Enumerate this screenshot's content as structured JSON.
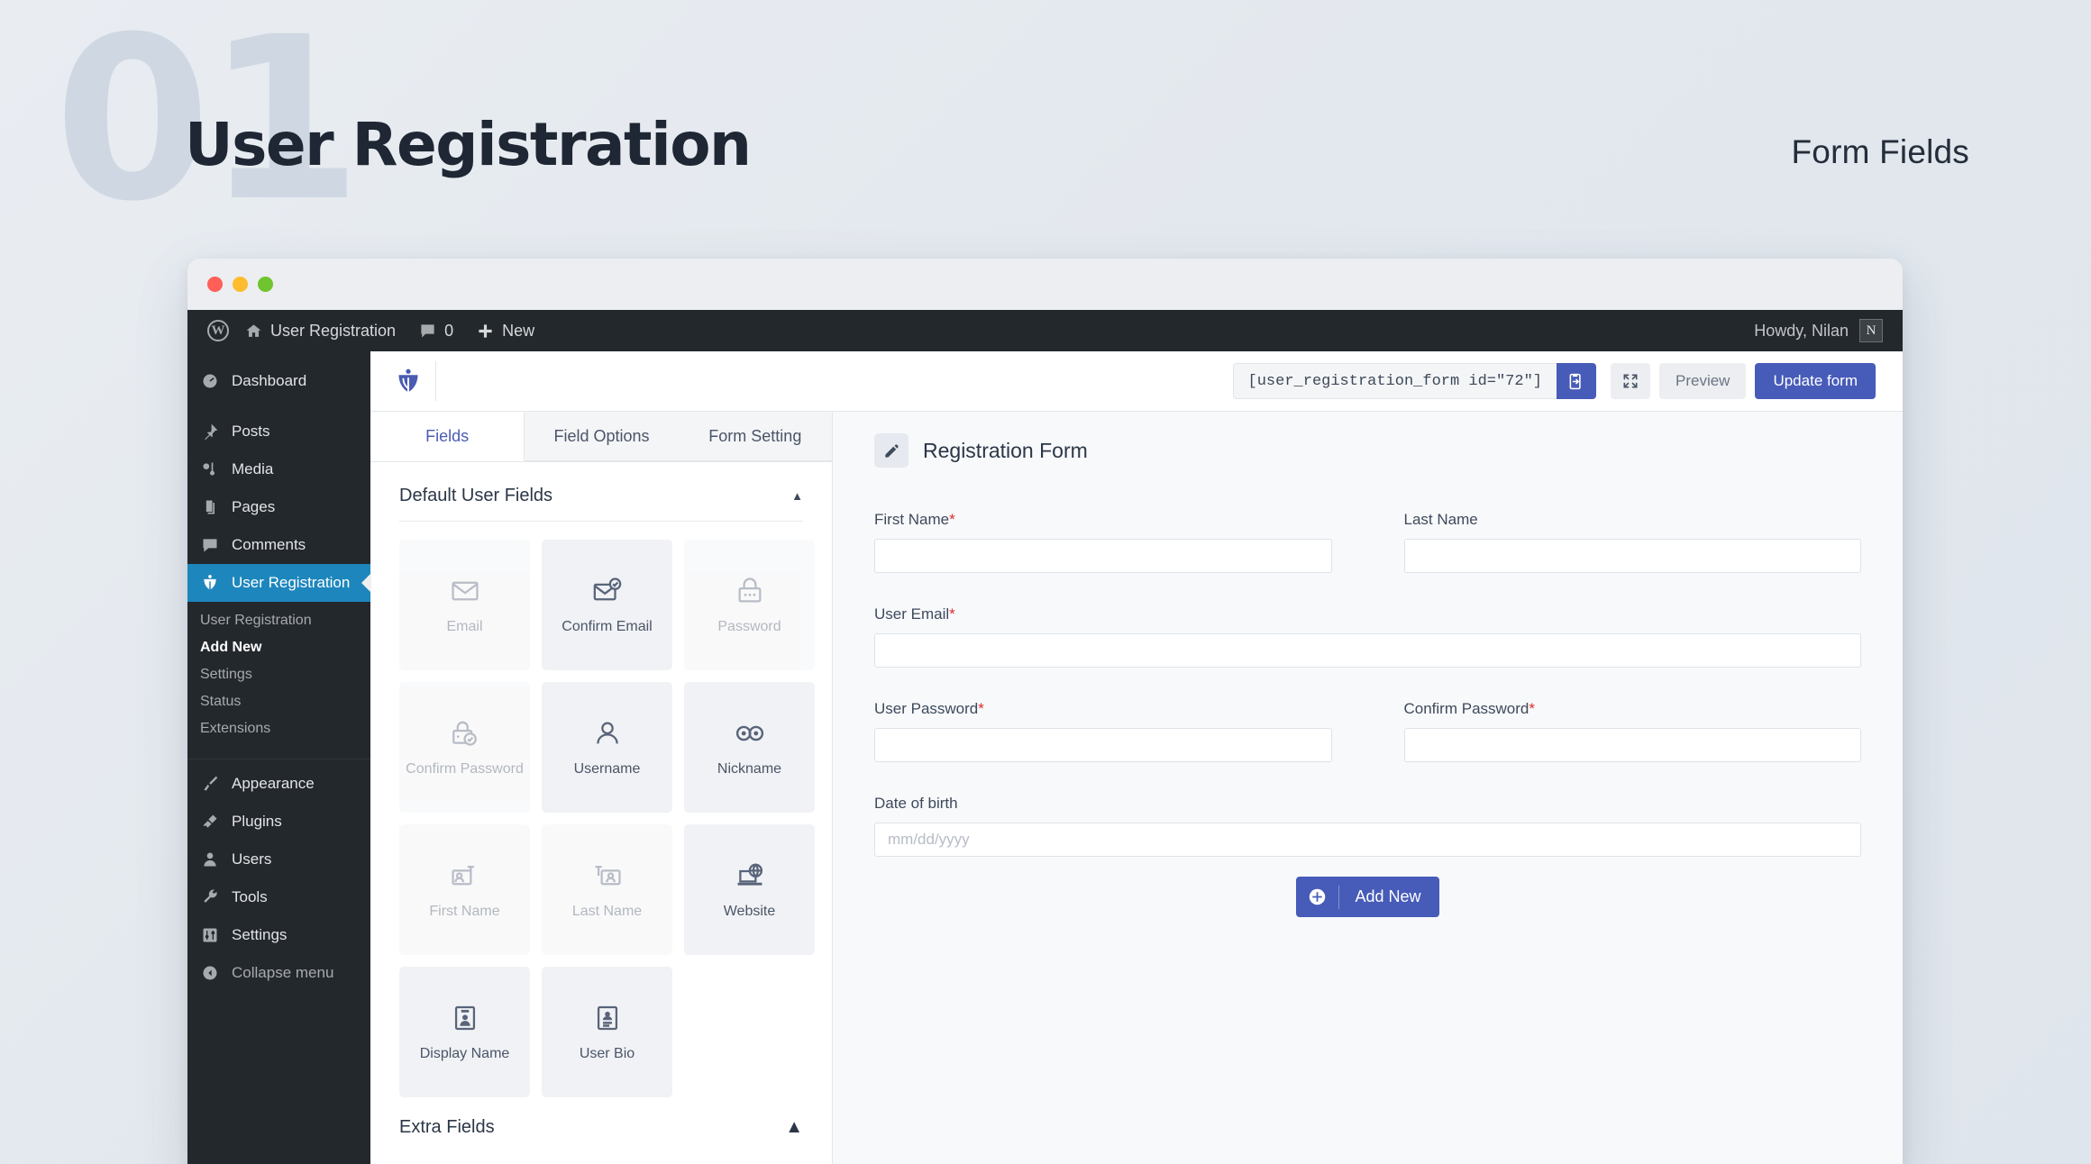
{
  "banner": {
    "number": "01",
    "title": "User Registration",
    "subtitle": "Form Fields"
  },
  "window": {
    "traffic_lights": [
      "close",
      "minimize",
      "maximize"
    ]
  },
  "adminbar": {
    "wp_logo": "wordpress-icon",
    "site_name": "User Registration",
    "comments_count": "0",
    "new_label": "New",
    "howdy": "Howdy, Nilan",
    "avatar_initial": "N"
  },
  "sidebar": {
    "items": [
      {
        "label": "Dashboard",
        "icon": "dashboard-icon"
      },
      {
        "label": "Posts",
        "icon": "pin-icon"
      },
      {
        "label": "Media",
        "icon": "media-icon"
      },
      {
        "label": "Pages",
        "icon": "pages-icon"
      },
      {
        "label": "Comments",
        "icon": "comments-icon"
      },
      {
        "label": "User Registration",
        "icon": "user-registration-icon",
        "active": true
      }
    ],
    "submenu": [
      {
        "label": "User Registration",
        "current": false
      },
      {
        "label": "Add New",
        "current": true
      },
      {
        "label": "Settings",
        "current": false
      },
      {
        "label": "Status",
        "current": false
      },
      {
        "label": "Extensions",
        "current": false
      }
    ],
    "items2": [
      {
        "label": "Appearance",
        "icon": "brush-icon"
      },
      {
        "label": "Plugins",
        "icon": "plug-icon"
      },
      {
        "label": "Users",
        "icon": "user-icon"
      },
      {
        "label": "Tools",
        "icon": "wrench-icon"
      },
      {
        "label": "Settings",
        "icon": "settings-icon"
      }
    ],
    "collapse": {
      "label": "Collapse menu",
      "icon": "collapse-icon"
    }
  },
  "toolbar": {
    "logo": "user-registration-logo",
    "shortcode": "[user_registration_form id=\"72\"]",
    "copy_icon": "copy-clipboard-icon",
    "expand_icon": "expand-icon",
    "preview_label": "Preview",
    "update_label": "Update form",
    "accent_color": "#475bb8"
  },
  "panel_left": {
    "tabs": [
      {
        "label": "Fields",
        "active": true
      },
      {
        "label": "Field Options",
        "active": false
      },
      {
        "label": "Form Setting",
        "active": false
      }
    ],
    "default_section": {
      "title": "Default User Fields",
      "caret": "▲"
    },
    "fields": [
      {
        "label": "Email",
        "icon": "envelope-icon",
        "used": true
      },
      {
        "label": "Confirm Email",
        "icon": "envelope-check-icon",
        "used": false
      },
      {
        "label": "Password",
        "icon": "lock-icon",
        "used": true
      },
      {
        "label": "Confirm Password",
        "icon": "lock-check-icon",
        "used": true
      },
      {
        "label": "Username",
        "icon": "person-icon",
        "used": false
      },
      {
        "label": "Nickname",
        "icon": "glasses-icon",
        "used": false
      },
      {
        "label": "First Name",
        "icon": "id-card-first-icon",
        "used": true
      },
      {
        "label": "Last Name",
        "icon": "id-card-last-icon",
        "used": true
      },
      {
        "label": "Website",
        "icon": "globe-laptop-icon",
        "used": false
      },
      {
        "label": "Display Name",
        "icon": "badge-person-icon",
        "used": false
      },
      {
        "label": "User Bio",
        "icon": "badge-lines-icon",
        "used": false
      }
    ],
    "extra_section": {
      "title": "Extra Fields",
      "caret": "▲"
    }
  },
  "preview": {
    "edit_icon": "pencil-icon",
    "form_name": "Registration Form",
    "rows": [
      [
        {
          "label": "First Name",
          "required": true,
          "placeholder": ""
        },
        {
          "label": "Last Name",
          "required": false,
          "placeholder": ""
        }
      ],
      [
        {
          "label": "User Email",
          "required": true,
          "placeholder": "",
          "full": true
        }
      ],
      [
        {
          "label": "User Password",
          "required": true,
          "placeholder": ""
        },
        {
          "label": "Confirm Password",
          "required": true,
          "placeholder": ""
        }
      ],
      [
        {
          "label": "Date of birth",
          "required": false,
          "placeholder": "mm/dd/yyyy",
          "full": true
        }
      ]
    ],
    "add_new": {
      "label": "Add New",
      "icon": "plus-circle-icon"
    }
  }
}
